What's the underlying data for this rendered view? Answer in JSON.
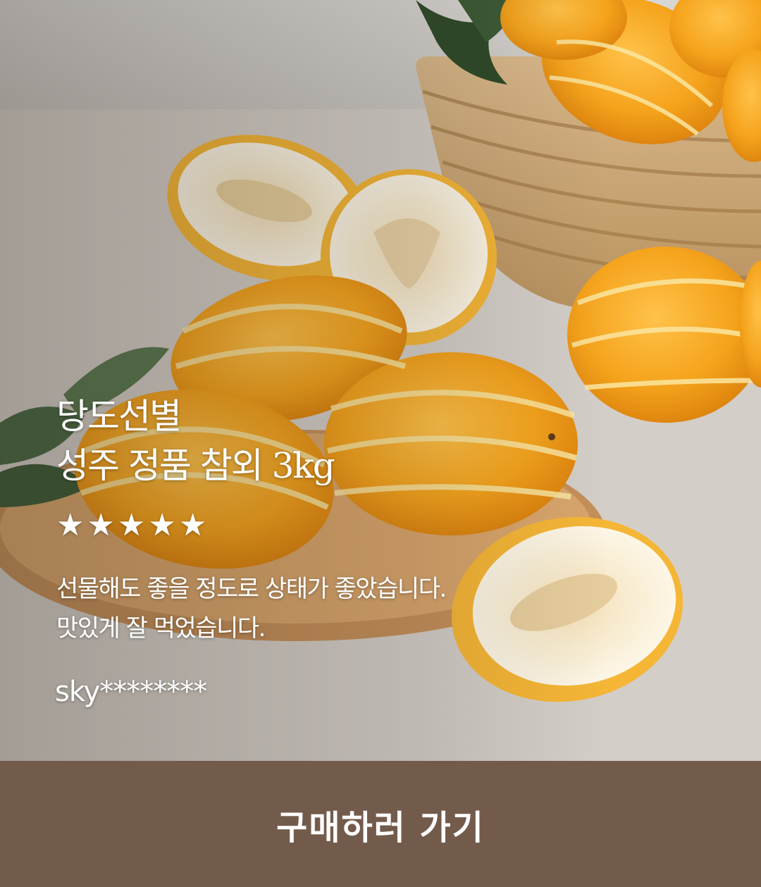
{
  "product": {
    "title_line1": "당도선별",
    "title_line2": "성주 정품 참외 3kg",
    "rating": 5,
    "stars": [
      "★",
      "★",
      "★",
      "★",
      "★"
    ],
    "review_line1": "선물해도 좋을 정도로 상태가 좋았습니다.",
    "review_line2": "맛있게 잘 먹었습니다.",
    "author": "sky********"
  },
  "cta": {
    "label": "구매하러 가기"
  },
  "colors": {
    "cta_background": "#735b4b",
    "text": "#ffffff",
    "melon": "#f2a11d",
    "melon_stripe": "#fbe6a0"
  }
}
